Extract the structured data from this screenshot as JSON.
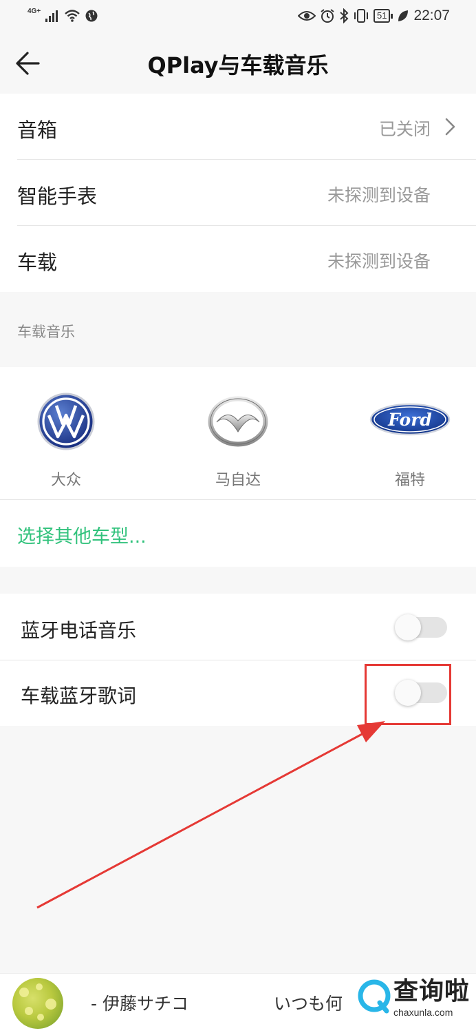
{
  "status_bar": {
    "network": "4G",
    "network_plus": "+",
    "battery": "51",
    "time": "22:07"
  },
  "header": {
    "title": "QPlay与车载音乐"
  },
  "devices": [
    {
      "label": "音箱",
      "value": "已关闭"
    },
    {
      "label": "智能手表",
      "value": "未探测到设备"
    },
    {
      "label": "车载",
      "value": "未探测到设备"
    }
  ],
  "car_music": {
    "section_label": "车载音乐",
    "brands": [
      {
        "name": "大众"
      },
      {
        "name": "马自达"
      },
      {
        "name": "福特"
      }
    ],
    "more_label": "选择其他车型..."
  },
  "settings": [
    {
      "label": "蓝牙电话音乐",
      "enabled": false
    },
    {
      "label": "车载蓝牙歌词",
      "enabled": false
    }
  ],
  "player": {
    "artist_text": "- 伊藤サチコ",
    "song_text": "いつも何"
  },
  "watermark": {
    "text": "查询啦",
    "url": "chaxunla.com"
  },
  "colors": {
    "accent": "#31c27c",
    "highlight": "#e53935"
  }
}
